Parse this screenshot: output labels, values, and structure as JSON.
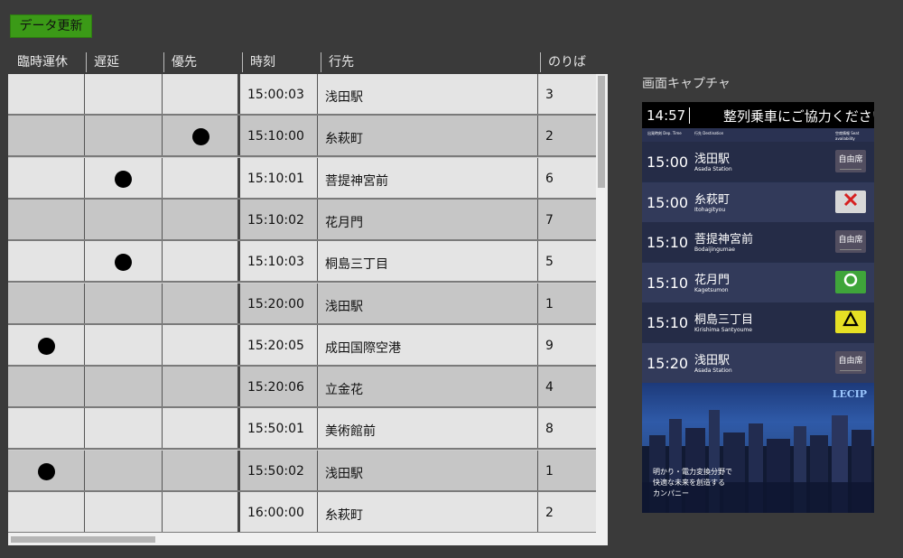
{
  "toolbar": {
    "update_label": "データ更新"
  },
  "columns": [
    "臨時運休",
    "遅延",
    "優先",
    "時刻",
    "行先",
    "のりば"
  ],
  "rows": [
    {
      "suspend": false,
      "delay": false,
      "priority": false,
      "time": "15:00:03",
      "dest": " 浅田駅",
      "platform": "3"
    },
    {
      "suspend": false,
      "delay": false,
      "priority": true,
      "time": "15:10:00",
      "dest": "糸萩町",
      "platform": "2"
    },
    {
      "suspend": false,
      "delay": true,
      "priority": false,
      "time": "15:10:01",
      "dest": "菩提神宮前",
      "platform": "6"
    },
    {
      "suspend": false,
      "delay": false,
      "priority": false,
      "time": "15:10:02",
      "dest": "花月門",
      "platform": "7"
    },
    {
      "suspend": false,
      "delay": true,
      "priority": false,
      "time": "15:10:03",
      "dest": "桐島三丁目",
      "platform": "5"
    },
    {
      "suspend": false,
      "delay": false,
      "priority": false,
      "time": "15:20:00",
      "dest": " 浅田駅",
      "platform": "1"
    },
    {
      "suspend": true,
      "delay": false,
      "priority": false,
      "time": "15:20:05",
      "dest": "成田国際空港",
      "platform": "9"
    },
    {
      "suspend": false,
      "delay": false,
      "priority": false,
      "time": "15:20:06",
      "dest": "立金花",
      "platform": "4"
    },
    {
      "suspend": false,
      "delay": false,
      "priority": false,
      "time": "15:50:01",
      "dest": "美術館前",
      "platform": "8"
    },
    {
      "suspend": true,
      "delay": false,
      "priority": false,
      "time": "15:50:02",
      "dest": " 浅田駅",
      "platform": "1"
    },
    {
      "suspend": false,
      "delay": false,
      "priority": false,
      "time": "16:00:00",
      "dest": "糸萩町",
      "platform": "2"
    }
  ],
  "capture": {
    "label": "画面キャプチャ",
    "clock": "14:57",
    "message": "整列乗車にご協力ください",
    "subheader": {
      "time_label": "出発時刻 Dep. Time",
      "dest_label": "行先 Destination",
      "seat_label": "空席情報 Seat availability"
    },
    "rows": [
      {
        "time": "15:00",
        "dest": "浅田駅",
        "roman": "Asada Station",
        "seat": "free",
        "seat_text": "自由席"
      },
      {
        "time": "15:00",
        "dest": "糸萩町",
        "roman": "Itohagityou",
        "seat": "full",
        "seat_text": ""
      },
      {
        "time": "15:10",
        "dest": "菩提神宮前",
        "roman": "Bodaijingumae",
        "seat": "free",
        "seat_text": "自由席"
      },
      {
        "time": "15:10",
        "dest": "花月門",
        "roman": "Kagetsumon",
        "seat": "avail",
        "seat_text": ""
      },
      {
        "time": "15:10",
        "dest": "桐島三丁目",
        "roman": "Kirishima Santyoume",
        "seat": "few",
        "seat_text": ""
      },
      {
        "time": "15:20",
        "dest": "浅田駅",
        "roman": "Asada Station",
        "seat": "free",
        "seat_text": "自由席"
      }
    ],
    "banner": {
      "logo": "LECIP",
      "slogan": [
        "明かり・電力変換分野で",
        "快適な未来を創造する",
        "カンパニー"
      ]
    }
  },
  "colors": {
    "background": "#3a3a3a",
    "button": "#3b9a17",
    "row_odd": "#e4e4e4",
    "row_even": "#c6c6c6",
    "panel": "#242d4a"
  }
}
